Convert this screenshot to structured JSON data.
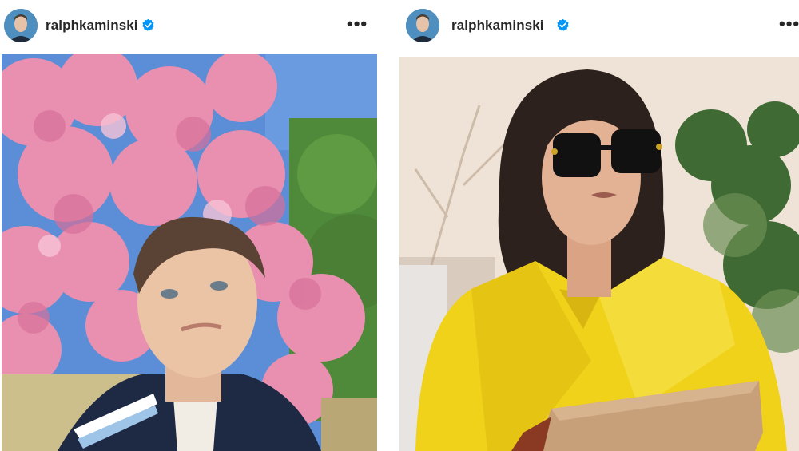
{
  "posts": [
    {
      "username": "ralphkaminski",
      "verified": true,
      "more_label": "•••",
      "icons": {
        "avatar": "avatar",
        "badge": "verified-badge-icon",
        "more": "more-options-icon"
      }
    },
    {
      "username": "ralphkaminski",
      "verified": true,
      "more_label": "•••",
      "icons": {
        "avatar": "avatar",
        "badge": "verified-badge-icon",
        "more": "more-options-icon"
      }
    }
  ],
  "colors": {
    "verified": "#0095f6",
    "text": "#262626",
    "coat": "#f0d21a",
    "blossom": "#e98fb0",
    "sky": "#5b8ed6"
  }
}
